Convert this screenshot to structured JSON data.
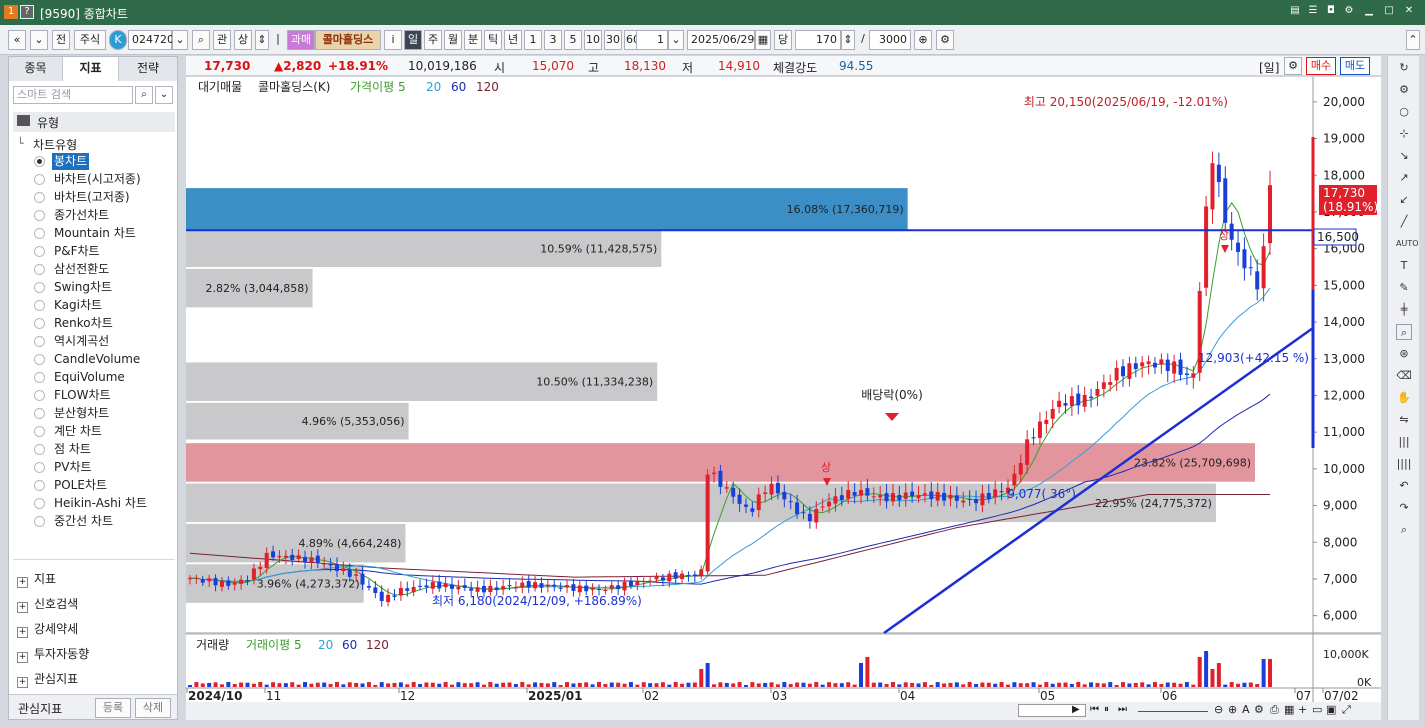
{
  "window": {
    "badge1": "1",
    "badge2": "?",
    "title": "[9590] 종합차트",
    "icons": [
      "memo-icon",
      "list-icon",
      "camera-icon",
      "settings-icon",
      "minimize-icon",
      "maximize-icon",
      "close-icon"
    ]
  },
  "toolbar": {
    "nav_prev": "«",
    "nav_down": "»",
    "jeon": "전",
    "stock_type": "주식",
    "k_badge": "K",
    "code": "024720",
    "gwan": "관",
    "sang": "상",
    "badge_tag": "과매",
    "stock_name": "콜마홀딩스",
    "info": "i",
    "periods": [
      "일",
      "주",
      "월",
      "분",
      "틱",
      "년"
    ],
    "intervals": [
      "1",
      "3",
      "5",
      "10",
      "30",
      "60"
    ],
    "interval_val": "1",
    "date": "2025/06/29",
    "dang": "당",
    "count": "170",
    "slash": "/",
    "total": "3000"
  },
  "left": {
    "tabs": [
      "종목",
      "지표",
      "전략"
    ],
    "search_placeholder": "스마트 검색",
    "section_type": "유형",
    "chart_type_title": "차트유형",
    "chart_types": [
      "봉차트",
      "바차트(시고저종)",
      "바차트(고저종)",
      "종가선차트",
      "Mountain 차트",
      "P&F차트",
      "삼선전환도",
      "Swing차트",
      "Kagi차트",
      "Renko차트",
      "역시계곡선",
      "CandleVolume",
      "EquiVolume",
      "FLOW차트",
      "분산형차트",
      "계단 차트",
      "점 차트",
      "PV차트",
      "POLE차트",
      "Heikin-Ashi 차트",
      "중간선 차트"
    ],
    "selected_type": "봉차트",
    "bottom_sections": [
      "지표",
      "신호검색",
      "강세약세",
      "투자자동향",
      "관심지표"
    ],
    "footer_label": "관심지표",
    "register": "등록",
    "delete": "삭제"
  },
  "quote": {
    "price": "17,730",
    "change": "▲2,820",
    "rate": "+18.91%",
    "volume": "10,019,186",
    "open_label": "시",
    "open": "15,070",
    "high_label": "고",
    "high": "18,130",
    "low_label": "저",
    "low": "14,910",
    "strength_label": "체결강도",
    "strength": "94.55",
    "period": "[일]",
    "buy": "매수",
    "sell": "매도"
  },
  "chart": {
    "legend": {
      "a": "대기매물",
      "b": "콜마홀딩스(K)",
      "c": "가격이평 5",
      "d": "20",
      "e": "60",
      "f": "120"
    },
    "y_ticks": [
      "20,000",
      "19,000",
      "18,000",
      "17,000",
      "16,000",
      "15,000",
      "14,000",
      "13,000",
      "12,000",
      "11,000",
      "10,000",
      "9,000",
      "8,000",
      "7,000",
      "6,000"
    ],
    "x_labels": [
      "2024/10",
      "11",
      "12",
      "2025/01",
      "02",
      "03",
      "04",
      "05",
      "06",
      "07",
      "07/02"
    ],
    "price_badge": "17,730",
    "price_badge2": "(18.91%)",
    "line_badge": "16,500",
    "high_note": "최고 20,150(2025/06/19, -12.01%)",
    "low_note": "최저 6,180(2024/12/09, +186.89%)",
    "div_note": "배당락(0%)",
    "trend_note1": "12,903(+42.15 %)",
    "trend_note2": "9,077( 36°)",
    "sang1": "상",
    "sang2": "상",
    "vol_legend": {
      "a": "거래량",
      "b": "거래이평 5",
      "c": "20",
      "d": "60",
      "e": "120"
    },
    "vol_ticks": [
      "10,000K",
      "0K"
    ]
  },
  "chart_data": {
    "type": "candlestick",
    "overlay": "volume-profile",
    "bars": [
      {
        "label": "16.08% (17,360,719)",
        "pct": 16.08,
        "vol": 17360719,
        "from": 16500,
        "to": 17650,
        "highlight": "blue"
      },
      {
        "label": "10.59% (11,428,575)",
        "pct": 10.59,
        "vol": 11428575,
        "from": 15500,
        "to": 16500
      },
      {
        "label": "2.82% (3,044,858)",
        "pct": 2.82,
        "vol": 3044858,
        "from": 14400,
        "to": 15450
      },
      {
        "label": "10.50% (11,334,238)",
        "pct": 10.5,
        "vol": 11334238,
        "from": 11850,
        "to": 12900
      },
      {
        "label": "4.96% (5,353,056)",
        "pct": 4.96,
        "vol": 5353056,
        "from": 10800,
        "to": 11800
      },
      {
        "label": "23.82% (25,709,698)",
        "pct": 23.82,
        "vol": 25709698,
        "from": 9650,
        "to": 10700,
        "highlight": "red"
      },
      {
        "label": "22.95% (24,775,372)",
        "pct": 22.95,
        "vol": 24775372,
        "from": 8550,
        "to": 9600
      },
      {
        "label": "4.89% (4,664,248)",
        "pct": 4.89,
        "vol": 4664248,
        "from": 7450,
        "to": 8500
      },
      {
        "label": "3.96% (4,273,372)",
        "pct": 3.96,
        "vol": 4273372,
        "from": 6350,
        "to": 7400
      }
    ],
    "ylim": [
      5500,
      20650
    ],
    "last_price": 17730,
    "line_level": 16500
  }
}
